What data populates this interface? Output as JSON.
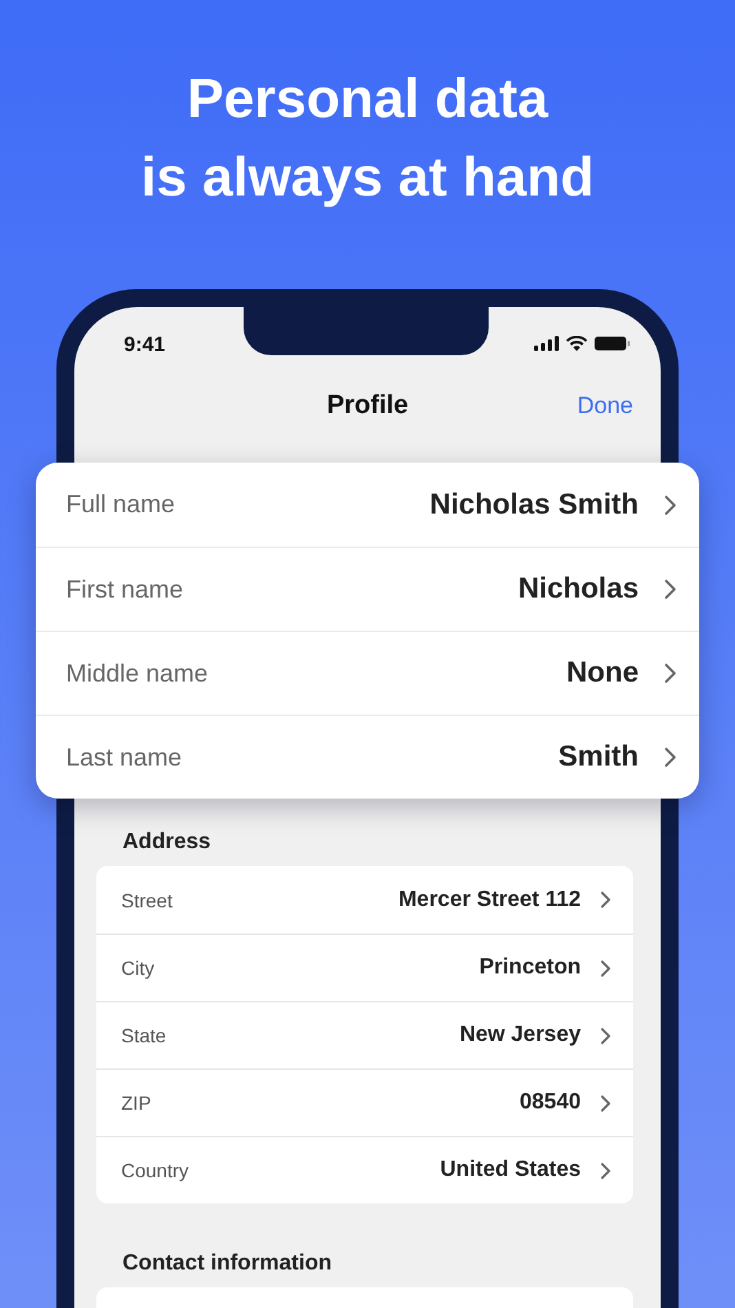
{
  "headline": [
    "Personal data",
    "is always at hand"
  ],
  "status_bar": {
    "time": "9:41"
  },
  "nav": {
    "title": "Profile",
    "action": "Done"
  },
  "name_card": [
    {
      "label": "Full name",
      "value": "Nicholas Smith"
    },
    {
      "label": "First name",
      "value": "Nicholas"
    },
    {
      "label": "Middle name",
      "value": "None"
    },
    {
      "label": "Last name",
      "value": "Smith"
    }
  ],
  "sections": [
    {
      "title": "Address",
      "rows": [
        {
          "label": "Street",
          "value": "Mercer Street 112"
        },
        {
          "label": "City",
          "value": "Princeton"
        },
        {
          "label": "State",
          "value": "New Jersey"
        },
        {
          "label": "ZIP",
          "value": "08540"
        },
        {
          "label": "Country",
          "value": "United States"
        }
      ]
    },
    {
      "title": "Contact information"
    }
  ]
}
